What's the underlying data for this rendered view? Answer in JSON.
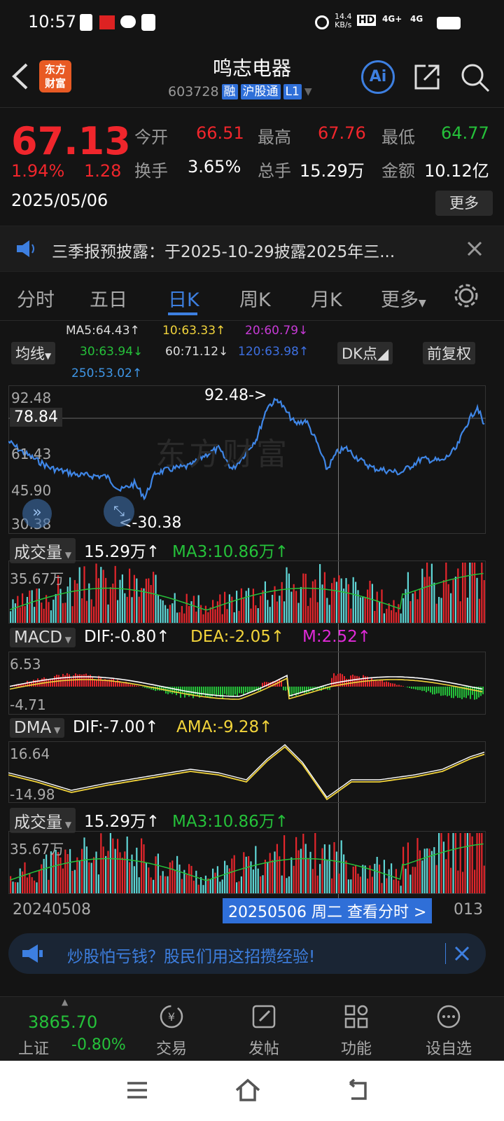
{
  "status": {
    "time": "10:57",
    "net_speed_top": "14.4",
    "net_speed_bottom": "KB/s",
    "hd": "HD",
    "sig1": "4G+",
    "sig2": "4G"
  },
  "header": {
    "title": "鸣志电器",
    "code": "603728",
    "tags": [
      "融",
      "沪股通",
      "L1"
    ],
    "logo_line1": "东方",
    "logo_line2": "财富",
    "ai_label": "Ai"
  },
  "quote": {
    "price": "67.13",
    "change_pct": "1.94%",
    "change": "1.28",
    "date": "2025/05/06",
    "open_label": "今开",
    "open": "66.51",
    "high_label": "最高",
    "high": "67.76",
    "low_label": "最低",
    "low": "64.77",
    "turnover_label": "换手",
    "turnover": "3.65%",
    "volume_label": "总手",
    "volume": "15.29万",
    "amount_label": "金额",
    "amount": "10.12亿",
    "more": "更多"
  },
  "notice": {
    "text": "三季报预披露：于2025-10-29披露2025年三..."
  },
  "tabs": [
    "分时",
    "五日",
    "日K",
    "周K",
    "月K",
    "更多"
  ],
  "active_tab": "日K",
  "ma": {
    "ma5": "MA5:64.43↑",
    "ma10": "10:63.33↑",
    "ma20": "20:60.79↓",
    "ma30": "30:63.94↓",
    "ma60": "60:71.12↓",
    "ma120": "120:63.98↑",
    "ma250": "250:53.02↑",
    "junxian": "均线",
    "dk": "DK点",
    "fuquan": "前复权"
  },
  "price_chart": {
    "y_max": "92.48",
    "y_cross": "78.84",
    "y_mid": "61.43",
    "y_low2": "45.90",
    "y_min": "30.38",
    "max_annot": "92.48->",
    "min_annot": "<-30.38",
    "watermark": "东方财富"
  },
  "volume1": {
    "label": "成交量",
    "value": "15.29万↑",
    "ma3": "MA3:10.86万↑",
    "axis": "35.67万"
  },
  "macd": {
    "label": "MACD",
    "dif": "DIF:-0.80↑",
    "dea": "DEA:-2.05↑",
    "m": "M:2.52↑",
    "top": "6.53",
    "bottom": "-4.71"
  },
  "dma": {
    "label": "DMA",
    "dif": "DIF:-7.00↑",
    "ama": "AMA:-9.28↑",
    "top": "16.64",
    "bottom": "-14.98"
  },
  "volume2": {
    "label": "成交量",
    "value": "15.29万↑",
    "ma3": "MA3:10.86万↑",
    "axis": "35.67万"
  },
  "xaxis": {
    "start": "20240508",
    "cursor": "20250506 周二 查看分时 >",
    "end": "013"
  },
  "ad": {
    "text": "炒股怕亏钱？股民们用这招攒经验!"
  },
  "bottomnav": {
    "index_value": "3865.70",
    "index_name": "上证",
    "index_change": "-0.80%",
    "trade": "交易",
    "post": "发帖",
    "func": "功能",
    "watch": "设自选"
  },
  "colors": {
    "up": "#f0262c",
    "down": "#25c13a",
    "accent": "#3d7fe0",
    "line": "#3f86e6"
  }
}
